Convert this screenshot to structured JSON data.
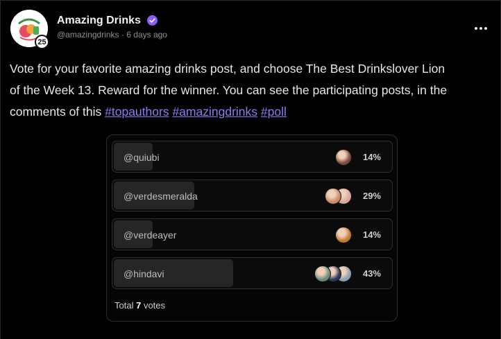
{
  "post": {
    "author": "Amazing Drinks",
    "handle": "@amazingdrinks",
    "separator": "·",
    "time": "6 days ago",
    "level": "25",
    "icons": {
      "avatar": "amazing-drinks-logo",
      "verified": "verified-check-icon",
      "menu": "more-options-icon"
    },
    "text": {
      "line1": "Vote for your favorite amazing drinks post, and choose The Best Drinkslover Lion",
      "line2": "of the Week 13. Reward for the winner. You can see the participating posts, in the",
      "line3_prefix": "comments of this ",
      "hashtags": [
        "#topauthors",
        "#amazingdrinks",
        "#poll"
      ]
    }
  },
  "poll": {
    "options": [
      {
        "label": "@quiubi",
        "percent": "14%",
        "share": 0.14,
        "voter_colors": [
          "#7a4a3a"
        ]
      },
      {
        "label": "@verdesmeralda",
        "percent": "29%",
        "share": 0.29,
        "voter_colors": [
          "#c98a6a",
          "#d9a7a0"
        ]
      },
      {
        "label": "@verdeayer",
        "percent": "14%",
        "share": 0.14,
        "voter_colors": [
          "#c07a30"
        ]
      },
      {
        "label": "@hindavi",
        "percent": "43%",
        "share": 0.43,
        "voter_colors": [
          "#6a8a7a",
          "#2a3a5a",
          "#8aa0b0"
        ]
      }
    ],
    "total_prefix": "Total",
    "total_count": "7",
    "total_suffix": "votes"
  },
  "colors": {
    "accent": "#8b7cf6",
    "verified": "#8b5cf6",
    "background": "#000000"
  }
}
